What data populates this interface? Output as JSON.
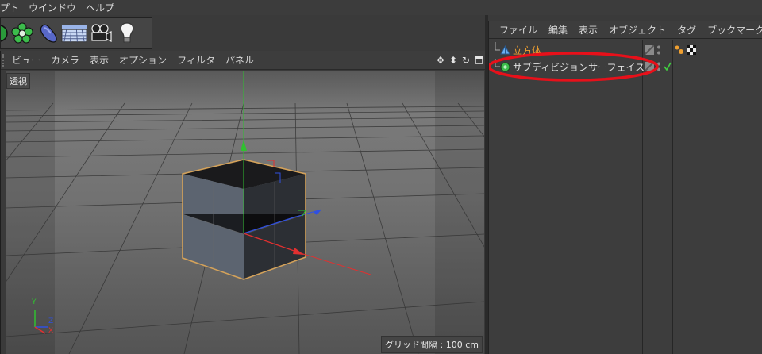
{
  "menubar": {
    "items": [
      "プト",
      "ウインドウ",
      "ヘルプ"
    ]
  },
  "toolbar": {
    "tools": [
      {
        "icon": "primitive-icon"
      },
      {
        "icon": "nurbs-flower-icon"
      },
      {
        "icon": "deformer-capsule-icon"
      },
      {
        "icon": "floor-plane-icon"
      },
      {
        "icon": "camera-icon"
      },
      {
        "icon": "light-bulb-icon"
      }
    ]
  },
  "viewport": {
    "menu": [
      "ビュー",
      "カメラ",
      "表示",
      "オプション",
      "フィルタ",
      "パネル"
    ],
    "nav_icons": [
      "move-view-icon",
      "zoom-view-icon",
      "rotate-view-icon",
      "maximize-view-icon"
    ],
    "camera_label": "透視",
    "grid_spacing": "グリッド間隔 : 100 cm",
    "axis_labels": {
      "y": "Y",
      "z": "Z",
      "x": "X"
    }
  },
  "object_manager": {
    "menu": [
      "ファイル",
      "編集",
      "表示",
      "オブジェクト",
      "タグ",
      "ブックマーク"
    ],
    "objects": [
      {
        "name": "立方体",
        "icon": "cube-icon",
        "color": "#f0a030"
      },
      {
        "name": "サブディビジョンサーフェイス",
        "icon": "subdivision-surface-icon",
        "color": "#e0e0e0"
      }
    ]
  },
  "colors": {
    "accent_orange": "#f0a030",
    "highlight_red": "#e8101a",
    "axis_x": "#e23030",
    "axis_y": "#30c030",
    "axis_z": "#3050e0"
  }
}
